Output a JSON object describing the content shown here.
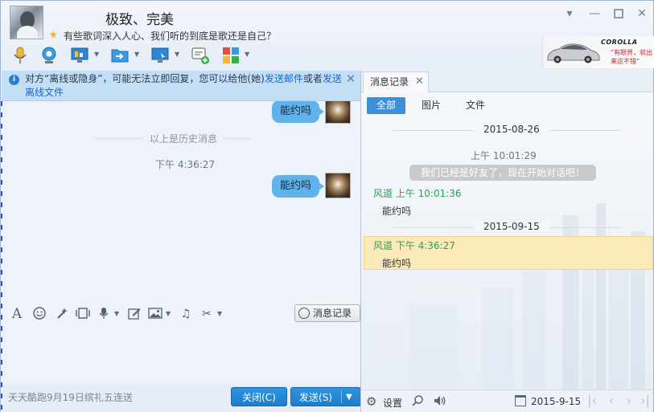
{
  "header": {
    "nickname": "极致、完美",
    "signature": "有些歌词深入人心、我们听的到底是歌还是自己？",
    "ad": {
      "title": "COROLLA",
      "slogan": "“有眼界，就出来这不错”"
    }
  },
  "notice": {
    "text_before": "对方“离线或隐身”，可能无法立即回复，您可以给他(她)",
    "link_email": "发送邮件",
    "text_mid": "或者",
    "link_file": "发送离线文件",
    "close_glyph": "✕"
  },
  "chat": {
    "messages": [
      {
        "text": "能约吗"
      },
      {
        "text": "能约吗"
      }
    ],
    "history_divider": "以上是历史消息",
    "time": "下午 4:36:27"
  },
  "input_toolbar": {
    "message_record": "消息记录"
  },
  "footer": {
    "ad_text": "天天酷跑9月19日缤礼五连送",
    "close_button": "关闭(C)",
    "send_button": "发送(S)"
  },
  "history_panel": {
    "tab_label": "消息记录",
    "filters": [
      "全部",
      "图片",
      "文件"
    ],
    "dates": [
      "2015-08-26",
      "2015-09-15"
    ],
    "system_time": "上午 10:01:29",
    "system_message": "我们已经是好友了，现在开始对话吧！",
    "entries": [
      {
        "sender": "风道 上午 10:01:36",
        "message": "能约吗"
      },
      {
        "sender": "风道 下午 4:36:27",
        "message": "能约吗"
      }
    ],
    "settings_label": "设置",
    "current_date": "2015-9-15"
  },
  "colors": {
    "accent_blue": "#1c7ccc",
    "bubble": "#5fb3ea",
    "sender_green": "#2aa15a",
    "highlight": "#fbe9b8"
  },
  "icons": [
    "microphone-icon",
    "camera-icon",
    "screen-share-icon",
    "folder-transfer-icon",
    "remote-desktop-icon",
    "new-discussion-icon",
    "apps-icon",
    "font-icon",
    "emoji-icon",
    "magic-icon",
    "screenshot-icon",
    "voice-icon",
    "edit-icon",
    "image-icon",
    "music-icon",
    "scissors-icon",
    "gear-icon",
    "search-icon",
    "speaker-icon",
    "calendar-icon"
  ]
}
